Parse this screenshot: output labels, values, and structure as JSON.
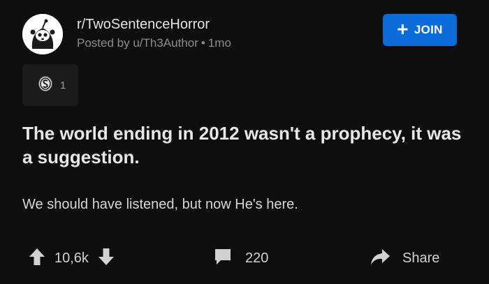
{
  "post": {
    "subreddit": "r/TwoSentenceHorror",
    "posted_by": "Posted by u/Th3Author",
    "age": "1mo",
    "join_label": "JOIN",
    "award_count": "1",
    "title": "The world ending in 2012 wasn't a prophecy, it was a suggestion.",
    "body": "We should have listened, but now He's here."
  },
  "actions": {
    "score": "10,6k",
    "comments": "220",
    "share_label": "Share"
  },
  "colors": {
    "background": "#0e0e0e",
    "join_button": "#0b6bd8",
    "text_primary": "#e6e7e8",
    "text_muted": "#8a8d90"
  },
  "icons": [
    "subreddit-avatar-icon",
    "plus-icon",
    "award-icon",
    "upvote-icon",
    "downvote-icon",
    "comment-icon",
    "share-icon"
  ]
}
